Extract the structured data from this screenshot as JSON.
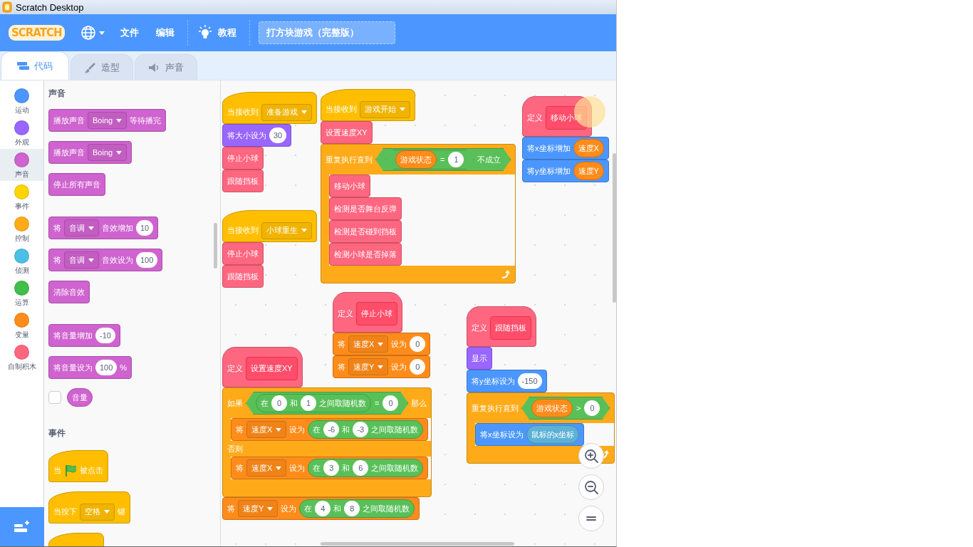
{
  "window": {
    "title": "Scratch Desktop"
  },
  "menu_bar": {
    "logo": "SCRATCH",
    "menus": [
      "文件",
      "编辑"
    ],
    "tutorials": "教程",
    "project_title": "打方块游戏（完整版）"
  },
  "tabs": [
    {
      "kind": "code",
      "label": "代码",
      "selected": true
    },
    {
      "kind": "costumes",
      "label": "造型",
      "selected": false
    },
    {
      "kind": "sounds",
      "label": "声音",
      "selected": false
    }
  ],
  "categories": [
    {
      "label": "运动",
      "color": "#4c97ff",
      "selected": false
    },
    {
      "label": "外观",
      "color": "#9966ff",
      "selected": false
    },
    {
      "label": "声音",
      "color": "#cf63cf",
      "selected": true
    },
    {
      "label": "事件",
      "color": "#ffd500",
      "selected": false
    },
    {
      "label": "控制",
      "color": "#ffab19",
      "selected": false
    },
    {
      "label": "侦测",
      "color": "#4cbfe6",
      "selected": false
    },
    {
      "label": "运算",
      "color": "#40bf4a",
      "selected": false
    },
    {
      "label": "变量",
      "color": "#ff8c1a",
      "selected": false
    },
    {
      "label": "自制积木",
      "color": "#ff6680",
      "selected": false
    }
  ],
  "palette": [
    {
      "kind": "heading",
      "text": "声音"
    },
    {
      "kind": "block",
      "block": {
        "kind": "stack",
        "color": "#cf63cf",
        "parts": [
          "播放声音",
          {
            "kind": "dropdown",
            "text": "Boing"
          },
          "等待播完"
        ]
      }
    },
    {
      "kind": "block",
      "block": {
        "kind": "stack",
        "color": "#cf63cf",
        "parts": [
          "播放声音",
          {
            "kind": "dropdown",
            "text": "Boing"
          }
        ]
      }
    },
    {
      "kind": "block",
      "block": {
        "kind": "stack",
        "color": "#cf63cf",
        "parts": [
          "停止所有声音"
        ]
      }
    },
    {
      "kind": "block",
      "block": {
        "kind": "stack",
        "color": "#cf63cf",
        "parts": [
          "将",
          {
            "kind": "dropdown",
            "text": "音调"
          },
          "音效增加",
          {
            "kind": "number",
            "text": "10"
          }
        ]
      }
    },
    {
      "kind": "block",
      "block": {
        "kind": "stack",
        "color": "#cf63cf",
        "parts": [
          "将",
          {
            "kind": "dropdown",
            "text": "音调"
          },
          "音效设为",
          {
            "kind": "number",
            "text": "100"
          }
        ]
      }
    },
    {
      "kind": "block",
      "block": {
        "kind": "stack",
        "color": "#cf63cf",
        "parts": [
          "清除音效"
        ]
      }
    },
    {
      "kind": "block",
      "block": {
        "kind": "stack",
        "color": "#cf63cf",
        "parts": [
          "将音量增加",
          {
            "kind": "number",
            "text": "-10"
          }
        ]
      }
    },
    {
      "kind": "block",
      "block": {
        "kind": "stack",
        "color": "#cf63cf",
        "parts": [
          "将音量设为",
          {
            "kind": "number",
            "text": "100"
          },
          "%"
        ]
      }
    },
    {
      "kind": "monitor",
      "checked": false,
      "block": {
        "kind": "reporter",
        "color": "#cf63cf",
        "parts": [
          "音量"
        ]
      }
    },
    {
      "kind": "heading",
      "text": "事件"
    },
    {
      "kind": "block",
      "block": {
        "kind": "hat",
        "color": "#ffbf00",
        "parts": [
          "当",
          {
            "kind": "flag"
          },
          "被点击"
        ]
      }
    },
    {
      "kind": "block",
      "block": {
        "kind": "hat",
        "color": "#ffbf00",
        "parts": [
          "当按下",
          {
            "kind": "dropdown",
            "text": "空格"
          },
          "键"
        ]
      }
    },
    {
      "kind": "block",
      "block": {
        "kind": "hat",
        "color": "#ffbf00"
      }
    }
  ],
  "scripts": [
    {
      "blocks": [
        {
          "kind": "hat",
          "color": "#ffbf00",
          "parts": [
            "当接收到",
            {
              "kind": "dropdown",
              "text": "准备游戏"
            }
          ]
        },
        {
          "kind": "stack",
          "color": "#9966ff",
          "parts": [
            "将大小设为",
            {
              "kind": "number",
              "text": "30"
            }
          ]
        },
        {
          "kind": "stack",
          "color": "#ff6680",
          "parts": [
            "停止小球"
          ]
        },
        {
          "kind": "stack",
          "color": "#ff6680",
          "parts": [
            "跟随挡板"
          ]
        }
      ]
    },
    {
      "blocks": [
        {
          "kind": "hat",
          "color": "#ffbf00",
          "parts": [
            "当接收到",
            {
              "kind": "dropdown",
              "text": "小球重生"
            }
          ]
        },
        {
          "kind": "stack",
          "color": "#ff6680",
          "parts": [
            "停止小球"
          ]
        },
        {
          "kind": "stack",
          "color": "#ff6680",
          "parts": [
            "跟随挡板"
          ]
        }
      ]
    },
    {
      "blocks": [
        {
          "kind": "hat",
          "color": "#ffbf00",
          "parts": [
            "当接收到",
            {
              "kind": "dropdown",
              "text": "游戏开始"
            }
          ]
        },
        {
          "kind": "stack",
          "color": "#ff6680",
          "parts": [
            "设置速度XY"
          ]
        },
        {
          "kind": "repeat",
          "color": "#ffab19",
          "parts": [
            "重复执行直到",
            {
              "kind": "boolean",
              "color": "#59c059",
              "parts": [
                {
                  "kind": "boolean",
                  "color": "#59c059",
                  "parts": [
                    {
                      "kind": "reporter",
                      "color": "#ff8c1a",
                      "parts": [
                        "游戏状态"
                      ]
                    },
                    "=",
                    {
                      "kind": "number",
                      "text": "1"
                    }
                  ]
                },
                "不成立"
              ]
            }
          ],
          "body": [
            {
              "kind": "stack",
              "color": "#ff6680",
              "parts": [
                "移动小球"
              ]
            },
            {
              "kind": "stack",
              "color": "#ff6680",
              "parts": [
                "检测是否舞台反弹"
              ]
            },
            {
              "kind": "stack",
              "color": "#ff6680",
              "parts": [
                "检测是否碰到挡板"
              ]
            },
            {
              "kind": "stack",
              "color": "#ff6680",
              "parts": [
                "检测小球是否掉落"
              ]
            }
          ]
        }
      ]
    },
    {
      "blocks": [
        {
          "kind": "define",
          "color": "#ff6680",
          "parts": [
            "定义",
            {
              "kind": "proto",
              "text": "移动小球"
            }
          ]
        },
        {
          "kind": "stack",
          "color": "#4c97ff",
          "parts": [
            "将x坐标增加",
            {
              "kind": "reporter",
              "color": "#ff8c1a",
              "parts": [
                "速度X"
              ]
            }
          ]
        },
        {
          "kind": "stack",
          "color": "#4c97ff",
          "parts": [
            "将y坐标增加",
            {
              "kind": "reporter",
              "color": "#ff8c1a",
              "parts": [
                "速度Y"
              ]
            }
          ]
        }
      ]
    },
    {
      "blocks": [
        {
          "kind": "define",
          "color": "#ff6680",
          "parts": [
            "定义",
            {
              "kind": "proto",
              "text": "停止小球"
            }
          ]
        },
        {
          "kind": "stack",
          "color": "#ff8c1a",
          "parts": [
            "将",
            {
              "kind": "dropdown",
              "text": "速度X"
            },
            "设为",
            {
              "kind": "number",
              "text": "0"
            }
          ]
        },
        {
          "kind": "stack",
          "color": "#ff8c1a",
          "parts": [
            "将",
            {
              "kind": "dropdown",
              "text": "速度Y"
            },
            "设为",
            {
              "kind": "number",
              "text": "0"
            }
          ]
        }
      ]
    },
    {
      "blocks": [
        {
          "kind": "define",
          "color": "#ff6680",
          "parts": [
            "定义",
            {
              "kind": "proto",
              "text": "跟随挡板"
            }
          ]
        },
        {
          "kind": "stack",
          "color": "#9966ff",
          "parts": [
            "显示"
          ]
        },
        {
          "kind": "stack",
          "color": "#4c97ff",
          "parts": [
            "将y坐标设为",
            {
              "kind": "number",
              "text": "-150"
            }
          ]
        },
        {
          "kind": "repeat",
          "color": "#ffab19",
          "parts": [
            "重复执行直到",
            {
              "kind": "boolean",
              "color": "#59c059",
              "parts": [
                {
                  "kind": "reporter",
                  "color": "#ff8c1a",
                  "parts": [
                    "游戏状态"
                  ]
                },
                ">",
                {
                  "kind": "number",
                  "text": "0"
                }
              ]
            }
          ],
          "body": [
            {
              "kind": "stack",
              "color": "#4c97ff",
              "parts": [
                "将x坐标设为",
                {
                  "kind": "reporter",
                  "color": "#5cb1d6",
                  "parts": [
                    "鼠标的x坐标"
                  ]
                }
              ]
            }
          ]
        }
      ]
    },
    {
      "blocks": [
        {
          "kind": "define",
          "color": "#ff6680",
          "parts": [
            "定义",
            {
              "kind": "proto",
              "text": "设置速度XY"
            }
          ]
        },
        {
          "kind": "ifelse",
          "color": "#ffab19",
          "parts": [
            "如果",
            {
              "kind": "boolean",
              "color": "#59c059",
              "parts": [
                {
                  "kind": "reporter",
                  "color": "#59c059",
                  "parts": [
                    "在",
                    {
                      "kind": "number",
                      "text": "0"
                    },
                    "和",
                    {
                      "kind": "number",
                      "text": "1"
                    },
                    "之间取随机数"
                  ]
                },
                "=",
                {
                  "kind": "number",
                  "text": "0"
                }
              ]
            },
            "那么"
          ],
          "body": [
            {
              "kind": "stack",
              "color": "#ff8c1a",
              "parts": [
                "将",
                {
                  "kind": "dropdown",
                  "text": "速度X"
                },
                "设为",
                {
                  "kind": "reporter",
                  "color": "#59c059",
                  "parts": [
                    "在",
                    {
                      "kind": "number",
                      "text": "-6"
                    },
                    "和",
                    {
                      "kind": "number",
                      "text": "-3"
                    },
                    "之间取随机数"
                  ]
                }
              ]
            }
          ],
          "else_label": "否则",
          "else_body": [
            {
              "kind": "stack",
              "color": "#ff8c1a",
              "parts": [
                "将",
                {
                  "kind": "dropdown",
                  "text": "速度X"
                },
                "设为",
                {
                  "kind": "reporter",
                  "color": "#59c059",
                  "parts": [
                    "在",
                    {
                      "kind": "number",
                      "text": "3"
                    },
                    "和",
                    {
                      "kind": "number",
                      "text": "6"
                    },
                    "之间取随机数"
                  ]
                }
              ]
            }
          ]
        },
        {
          "kind": "stack",
          "color": "#ff8c1a",
          "parts": [
            "将",
            {
              "kind": "dropdown",
              "text": "速度Y"
            },
            "设为",
            {
              "kind": "reporter",
              "color": "#59c059",
              "parts": [
                "在",
                {
                  "kind": "number",
                  "text": "4"
                },
                "和",
                {
                  "kind": "number",
                  "text": "8"
                },
                "之间取随机数"
              ]
            }
          ]
        }
      ]
    }
  ]
}
